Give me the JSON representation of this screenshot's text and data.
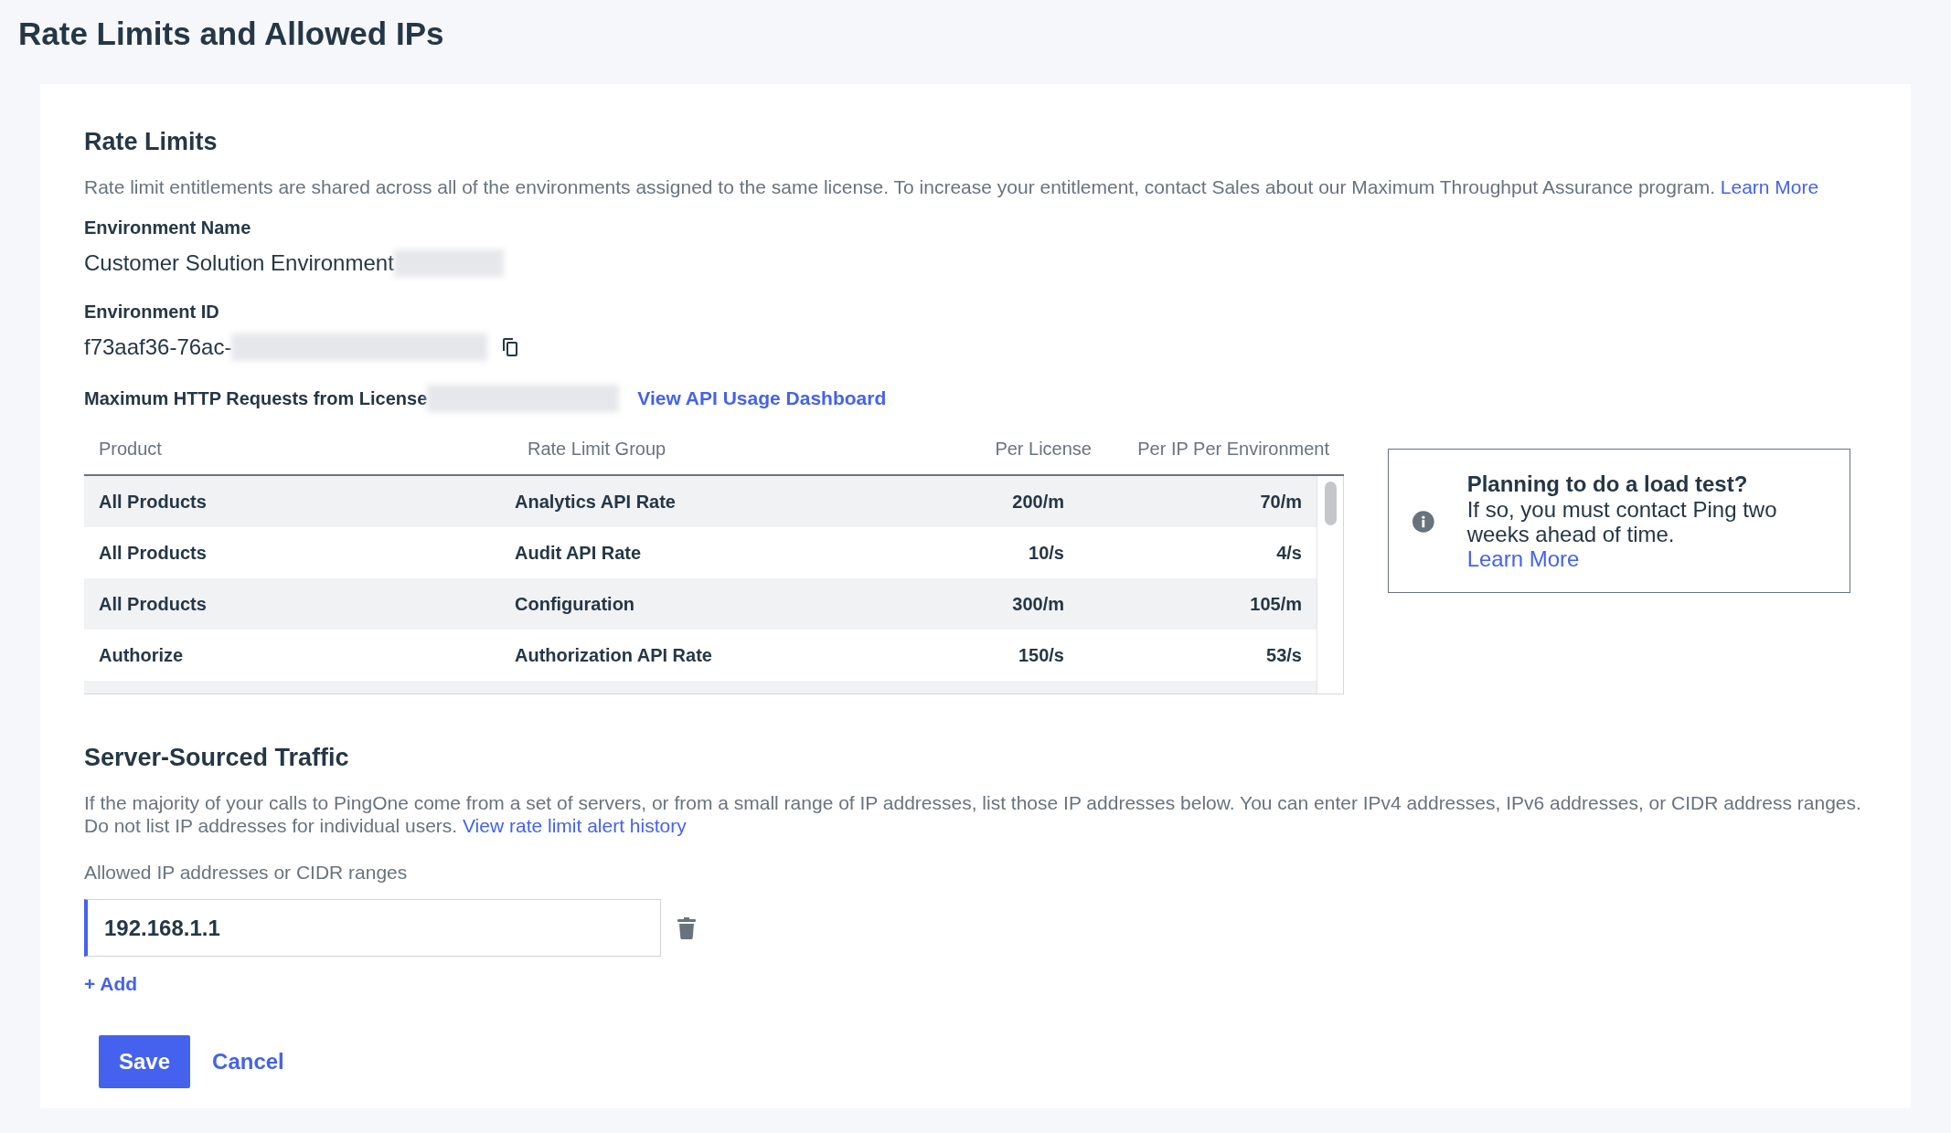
{
  "page": {
    "title": "Rate Limits and Allowed IPs"
  },
  "rate_limits": {
    "heading": "Rate Limits",
    "description": "Rate limit entitlements are shared across all of the environments assigned to the same license. To increase your entitlement, contact Sales about our Maximum Throughput Assurance program.",
    "description_link": "Learn More",
    "fields": [
      {
        "kind": "text",
        "label": "Environment Name",
        "value": "Customer Solution Environment",
        "redacted": true
      },
      {
        "kind": "copyable",
        "label": "Environment ID",
        "value": "f73aaf36-76ac-",
        "redacted": true
      }
    ],
    "max_requests": {
      "label": "Maximum HTTP Requests from License",
      "redacted": true,
      "link": "View API Usage Dashboard"
    },
    "table": {
      "columns": [
        "Product",
        "Rate Limit Group",
        "Per License",
        "Per IP Per Environment"
      ],
      "rows": [
        [
          "All Products",
          "Analytics API Rate",
          "200/m",
          "70/m"
        ],
        [
          "All Products",
          "Audit API Rate",
          "10/s",
          "4/s"
        ],
        [
          "All Products",
          "Configuration",
          "300/m",
          "105/m"
        ],
        [
          "Authorize",
          "Authorization API Rate",
          "150/s",
          "53/s"
        ]
      ]
    }
  },
  "notice": {
    "title": "Planning to do a load test?",
    "text": "If so, you must contact Ping two weeks ahead of time.",
    "link": "Learn More"
  },
  "server_traffic": {
    "heading": "Server-Sourced Traffic",
    "description": "If the majority of your calls to PingOne come from a set of servers, or from a small range of IP addresses, list those IP addresses below. You can enter IPv4 addresses, IPv6 addresses, or CIDR address ranges. Do not list IP addresses for individual users.",
    "description_link": "View rate limit alert history",
    "field_label": "Allowed IP addresses or CIDR ranges",
    "entries": [
      {
        "value": "192.168.1.1"
      }
    ],
    "add_link": "+ Add"
  },
  "actions": [
    {
      "label": "Save",
      "kind": "primary"
    },
    {
      "label": "Cancel",
      "kind": "link"
    }
  ]
}
